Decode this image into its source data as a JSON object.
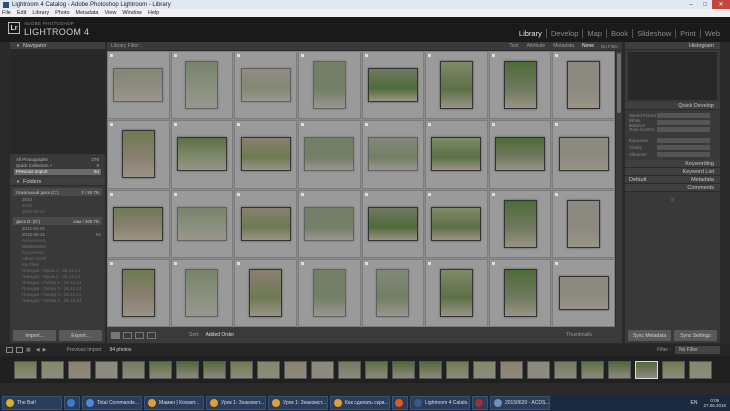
{
  "window": {
    "title": "Lightroom 4 Catalog - Adobe Photoshop Lightroom - Library",
    "menu": [
      "File",
      "Edit",
      "Library",
      "Photo",
      "Metadata",
      "View",
      "Window",
      "Help"
    ]
  },
  "brand": {
    "sub": "ADOBE PHOTOSHOP",
    "name": "LIGHTROOM 4",
    "logo": "Lr"
  },
  "modules": [
    "Library",
    "Develop",
    "Map",
    "Book",
    "Slideshow",
    "Print",
    "Web"
  ],
  "active_module": "Library",
  "left": {
    "navigator_title": "Navigator",
    "catalog": [
      {
        "label": "All Photographs",
        "count": "276"
      },
      {
        "label": "Quick Collection +",
        "count": "0"
      },
      {
        "label": "Previous Import",
        "count": "94"
      }
    ],
    "folders_title": "Folders",
    "volumes": [
      {
        "name": "Локальный диск (C:)",
        "space": "3 / 92 ГБ"
      },
      {
        "name": "Диск D: (D:)",
        "space": "кам / 465 ГБ"
      }
    ],
    "folders_c": [
      {
        "name": "2014",
        "count": ""
      },
      {
        "name": "2015",
        "count": ""
      },
      {
        "name": "2015-06-21",
        "count": ""
      }
    ],
    "folders_d": [
      {
        "name": "2012-01-01",
        "count": ""
      },
      {
        "name": "2015-06-21",
        "count": "94"
      },
      {
        "name": "AAAAAAAA",
        "count": ""
      },
      {
        "name": "BBBBBBBB",
        "count": ""
      },
      {
        "name": "Documents",
        "count": ""
      },
      {
        "name": "Album 2015",
        "count": ""
      },
      {
        "name": "My Files",
        "count": ""
      },
      {
        "name": "Поездка - Крым 1 - 26.12.14",
        "count": ""
      },
      {
        "name": "Поездка - Крым 2 - 26.12.14",
        "count": ""
      },
      {
        "name": "Поездка - Питер 1 - 26.12.14",
        "count": ""
      },
      {
        "name": "Поездка - Питер 2 - 26.12.14",
        "count": ""
      },
      {
        "name": "Поездка - Питер 3 - 26.12.14",
        "count": ""
      },
      {
        "name": "Поездка - Питер 4 - 26.12.14",
        "count": ""
      }
    ],
    "import_label": "Import...",
    "export_label": "Export..."
  },
  "filter": {
    "label": "Library Filter :",
    "options": [
      "Text",
      "Attribute",
      "Metadata",
      "None"
    ],
    "active": "None",
    "no_filter": "No Filter"
  },
  "grid": {
    "cells": [
      {
        "n": "",
        "o": "l",
        "d": true
      },
      {
        "n": "",
        "o": "p",
        "d": true
      },
      {
        "n": "",
        "o": "l",
        "d": true
      },
      {
        "n": "",
        "o": "p",
        "d": true
      },
      {
        "n": "",
        "o": "l",
        "d": false
      },
      {
        "n": "",
        "o": "p",
        "d": false
      },
      {
        "n": "",
        "o": "p",
        "d": false
      },
      {
        "n": "",
        "o": "p",
        "d": false
      },
      {
        "n": "",
        "o": "p",
        "d": false
      },
      {
        "n": "",
        "o": "l",
        "d": false
      },
      {
        "n": "",
        "o": "l",
        "d": false
      },
      {
        "n": "",
        "o": "l",
        "d": true
      },
      {
        "n": "",
        "o": "l",
        "d": true
      },
      {
        "n": "",
        "o": "l",
        "d": false
      },
      {
        "n": "",
        "o": "l",
        "d": false
      },
      {
        "n": "",
        "o": "l",
        "d": false
      },
      {
        "n": "",
        "o": "l",
        "d": false
      },
      {
        "n": "",
        "o": "l",
        "d": true
      },
      {
        "n": "",
        "o": "l",
        "d": false
      },
      {
        "n": "",
        "o": "l",
        "d": true
      },
      {
        "n": "",
        "o": "l",
        "d": false
      },
      {
        "n": "",
        "o": "l",
        "d": false
      },
      {
        "n": "",
        "o": "p",
        "d": false
      },
      {
        "n": "",
        "o": "p",
        "d": false
      },
      {
        "n": "",
        "o": "p",
        "d": false
      },
      {
        "n": "",
        "o": "p",
        "d": true
      },
      {
        "n": "",
        "o": "p",
        "d": false
      },
      {
        "n": "",
        "o": "p",
        "d": true
      },
      {
        "n": "",
        "o": "p",
        "d": true
      },
      {
        "n": "",
        "o": "p",
        "d": false
      },
      {
        "n": "",
        "o": "p",
        "d": false
      },
      {
        "n": "",
        "o": "l",
        "d": false
      }
    ],
    "colors": [
      "#6e7a52",
      "#5c7046",
      "#8a8070",
      "#55693f",
      "#707a60",
      "#7f8a6a",
      "#4f6a38",
      "#8c8a80"
    ]
  },
  "toolbar": {
    "sort_label": "Sort:",
    "sort_value": "Added Order",
    "thumbnails": "Thumbnails"
  },
  "right": {
    "histogram": "Histogram",
    "quick_develop": "Quick Develop",
    "qd_rows": [
      "Saved Preset",
      "White Balance",
      "Tone Control",
      "Exposure",
      "Clarity",
      "Vibrance"
    ],
    "keywording": "Keywording",
    "keyword_list": "Keyword List",
    "metadata": "Metadata",
    "metadata_preset": "Default",
    "comments": "Comments",
    "sync_metadata": "Sync Metadata",
    "sync_settings": "Sync Settings"
  },
  "filmstrip": {
    "source": "Previous Import",
    "count": "94 photos",
    "filter_label": "Filter :",
    "filter_value": "No Filter",
    "thumbs": 26
  },
  "taskbar": {
    "items": [
      {
        "label": "The Bat!",
        "color": "#d8b020"
      },
      {
        "label": "",
        "color": "#3a7ad0"
      },
      {
        "label": "Total Commande...",
        "color": "#4a8ad8"
      },
      {
        "label": "Мамин | Космет...",
        "color": "#e0a030"
      },
      {
        "label": "Урок 1: Знакомст...",
        "color": "#e0a030"
      },
      {
        "label": "Урок 1: Знакомст...",
        "color": "#e0a030"
      },
      {
        "label": "Как сделать скри...",
        "color": "#e0a030"
      },
      {
        "label": "",
        "color": "#e05a20"
      },
      {
        "label": "Lightroom 4 Catalo...",
        "color": "#3a5a8a"
      },
      {
        "label": "",
        "color": "#a03030"
      },
      {
        "label": "20150620 - ACDS...",
        "color": "#7090c0"
      }
    ],
    "lang": "EN",
    "time": "0:05",
    "date": "27.06.2015"
  }
}
